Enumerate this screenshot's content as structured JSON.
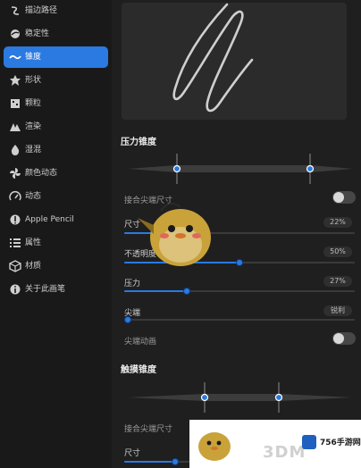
{
  "sidebar": {
    "items": [
      {
        "label": "描边路径",
        "icon": "stroke-path-icon",
        "active": false
      },
      {
        "label": "稳定性",
        "icon": "stabilization-icon",
        "active": false
      },
      {
        "label": "锥度",
        "icon": "taper-icon",
        "active": true
      },
      {
        "label": "形状",
        "icon": "shape-icon",
        "active": false
      },
      {
        "label": "颗粒",
        "icon": "grain-icon",
        "active": false
      },
      {
        "label": "渲染",
        "icon": "rendering-icon",
        "active": false
      },
      {
        "label": "湿混",
        "icon": "wet-mix-icon",
        "active": false
      },
      {
        "label": "颜色动态",
        "icon": "color-dynamics-icon",
        "active": false
      },
      {
        "label": "动态",
        "icon": "dynamics-icon",
        "active": false
      },
      {
        "label": "Apple Pencil",
        "icon": "apple-pencil-icon",
        "active": false
      },
      {
        "label": "属性",
        "icon": "properties-icon",
        "active": false
      },
      {
        "label": "材质",
        "icon": "materials-icon",
        "active": false
      },
      {
        "label": "关于此画笔",
        "icon": "about-icon",
        "active": false
      }
    ]
  },
  "main": {
    "pressure_taper": {
      "title": "压力锥度",
      "taper_start": 0.22,
      "taper_end": 0.81,
      "tip_size_link_label": "接合尖端尺寸",
      "tip_size_link_on": false,
      "size": {
        "label": "尺寸",
        "value_text": "22%",
        "fraction": 0.22
      },
      "opacity": {
        "label": "不透明度",
        "value_text": "50%",
        "fraction": 0.5
      },
      "pressure": {
        "label": "压力",
        "value_text": "27%",
        "fraction": 0.27
      },
      "tip": {
        "label": "尖端",
        "value_text": "锐利",
        "fraction": 0.0
      },
      "tip_animation_label": "尖端动画",
      "tip_animation_on": false
    },
    "touch_taper": {
      "title": "触摸锥度",
      "taper_start": 0.34,
      "taper_end": 0.67,
      "tip_size_link_label": "接合尖端尺寸",
      "size": {
        "label": "尺寸",
        "fraction": 0.22
      }
    }
  },
  "watermark": {
    "brand_text": "756手游网",
    "site_text": "3DM",
    "logo_icon": "game-logo-icon"
  },
  "colors": {
    "accent": "#2a7ae2",
    "sidebar_bg": "#191919",
    "panel_bg": "#1f1f1f"
  }
}
